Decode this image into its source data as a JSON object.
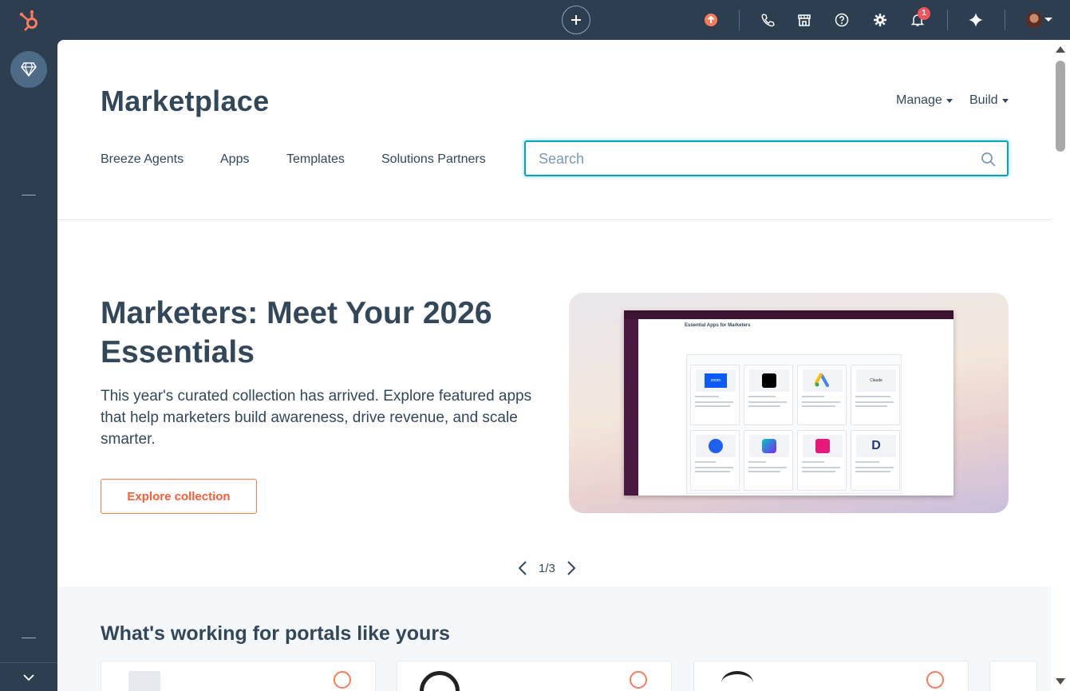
{
  "topbar": {
    "notifications_count": "1"
  },
  "header": {
    "title": "Marketplace",
    "manage_label": "Manage",
    "build_label": "Build"
  },
  "nav": {
    "tabs": [
      {
        "label": "Breeze Agents"
      },
      {
        "label": "Apps"
      },
      {
        "label": "Templates"
      },
      {
        "label": "Solutions Partners"
      }
    ]
  },
  "search": {
    "placeholder": "Search",
    "value": ""
  },
  "hero": {
    "title": "Marketers: Meet Your 2026 Essentials",
    "description": "This year's curated collection has arrived. Explore featured apps that help marketers build awareness, drive revenue, and scale smarter.",
    "button_label": "Explore collection",
    "image_heading": "Essential Apps for Marketers",
    "image_apps": [
      "zoom",
      "TikTok",
      "Google Ads",
      "Claude",
      "Amplitude",
      "Canva",
      "Stackline",
      "Demandbase"
    ]
  },
  "pager": {
    "text": "1/3"
  },
  "section": {
    "title": "What's working for portals like yours"
  },
  "colors": {
    "navy": "#2d3e50",
    "text": "#33475b",
    "accent_teal": "#00a4bd",
    "accent_orange": "#ff7a59",
    "section_bg": "#f5f8fa"
  },
  "icons": [
    "hubspot-logo-icon",
    "plus-icon",
    "upgrade-icon",
    "phone-icon",
    "marketplace-icon",
    "help-icon",
    "settings-icon",
    "bell-icon",
    "sparkle-icon",
    "gem-icon",
    "search-icon",
    "chevron-left-icon",
    "chevron-right-icon",
    "chevron-down-icon"
  ]
}
